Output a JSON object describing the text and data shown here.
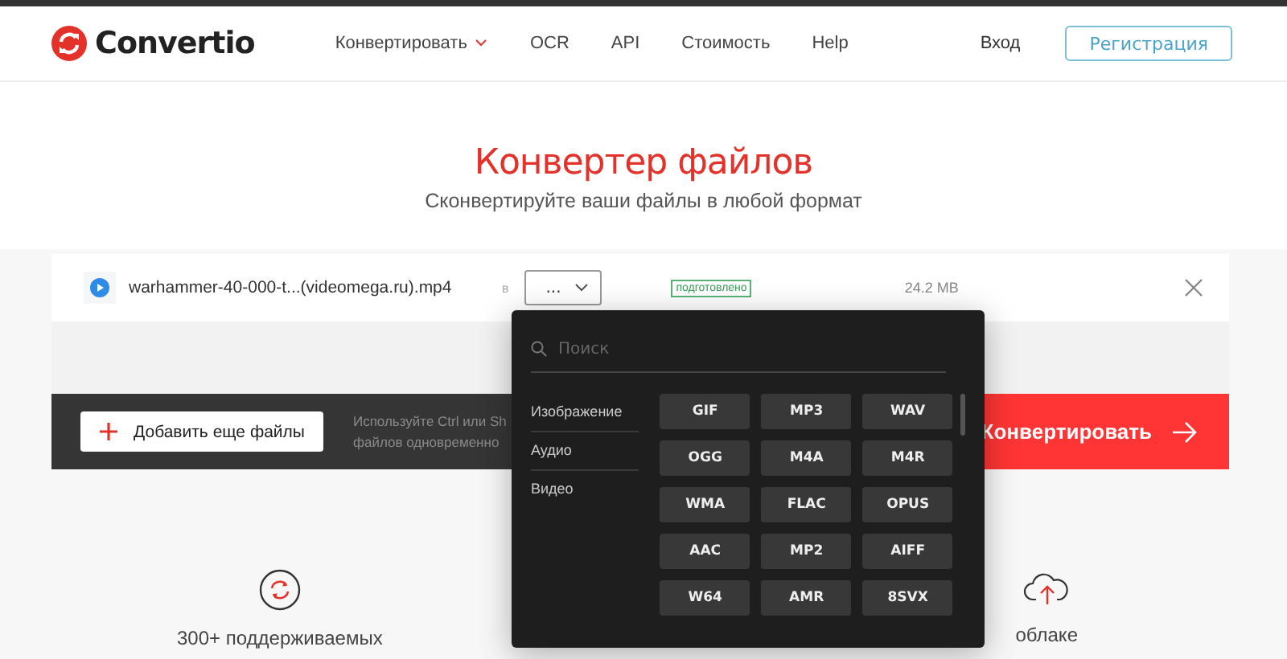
{
  "header": {
    "logo": "Convertio",
    "nav": [
      {
        "label": "Конвертировать",
        "dropdown": true
      },
      {
        "label": "OCR",
        "dropdown": false
      },
      {
        "label": "API",
        "dropdown": false
      },
      {
        "label": "Стоимость",
        "dropdown": false
      },
      {
        "label": "Help",
        "dropdown": false
      }
    ],
    "login": "Вход",
    "register": "Регистрация"
  },
  "hero": {
    "title": "Конвертер файлов",
    "subtitle": "Сконвертируйте ваши файлы в любой формат"
  },
  "file": {
    "name": "warhammer-40-000-t...(videomega.ru).mp4",
    "to_label": "в",
    "format": "...",
    "status": "подготовлено",
    "size": "24.2 MB"
  },
  "actions": {
    "add": "Добавить еще файлы",
    "hint_lines": [
      "Используйте Ctrl или Sh",
      "файлов одновременно"
    ],
    "convert": "Конвертировать"
  },
  "dropdown": {
    "placeholder": "Поиск",
    "categories": [
      "Изображение",
      "Аудио",
      "Видео"
    ],
    "formats": [
      "GIF",
      "MP3",
      "WAV",
      "OGG",
      "M4A",
      "M4R",
      "WMA",
      "FLAC",
      "OPUS",
      "AAC",
      "MP2",
      "AIFF",
      "W64",
      "AMR",
      "8SVX"
    ]
  },
  "features": [
    {
      "kind": "convert",
      "text": "300+ поддерживаемых"
    },
    {
      "kind": "cloud",
      "text": "облаке"
    }
  ]
}
